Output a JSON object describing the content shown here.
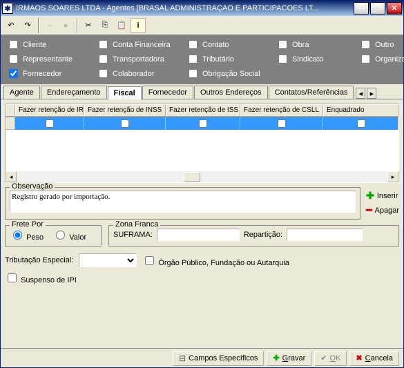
{
  "window": {
    "title": "IRMAOS SOARES LTDA -  Agentes [BRASAL ADMINISTRAÇAO E PARTICIPACOES LT..."
  },
  "filters": {
    "cliente": "Cliente",
    "conta_financeira": "Conta Financeira",
    "contato": "Contato",
    "obra": "Obra",
    "outro": "Outro",
    "representante": "Representante",
    "transportadora": "Transportadora",
    "tributario": "Tributário",
    "sindicato": "Sindicato",
    "organizacao": "Organização",
    "fornecedor": "Fornecedor",
    "colaborador": "Colaborador",
    "obrigacao_social": "Obrigação Social"
  },
  "tabs": {
    "agente": "Agente",
    "enderecamento": "Endereçamento",
    "fiscal": "Fiscal",
    "fornecedor": "Fornecedor",
    "outros_enderecos": "Outros Endereços",
    "contatos_ref": "Contatos/Referências"
  },
  "grid": {
    "cols": {
      "c1": "Fazer retenção de IR",
      "c2": "Fazer retenção de INSS",
      "c3": "Fazer retenção de ISS",
      "c4": "Fazer retenção de CSLL",
      "c5": "Enquadrado"
    }
  },
  "obs": {
    "legend": "Observação",
    "value": "Registro gerado por importação."
  },
  "side": {
    "inserir": "Inserir",
    "apagar": "Apagar"
  },
  "frete": {
    "legend": "Frete Por",
    "peso": "Peso",
    "valor": "Valor"
  },
  "zona": {
    "legend": "Zona Franca",
    "suframa": "SUFRAMA:",
    "reparticao": "Repartição:"
  },
  "trib": {
    "label": "Tributação Especial:",
    "orgao": "Órgão Público, Fundação ou Autarquia",
    "suspenso": "Suspenso de IPI"
  },
  "buttons": {
    "campos": "Campos Específicos",
    "gravar": "Gravar",
    "ok": "OK",
    "cancela": "Cancela"
  }
}
